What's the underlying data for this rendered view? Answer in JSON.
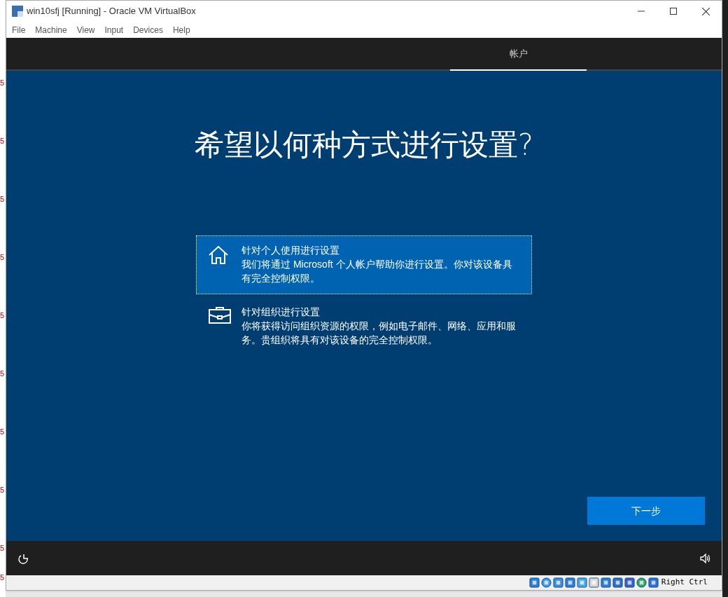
{
  "background": {
    "edge_marks": [
      "5",
      "5",
      "5",
      "5",
      "5",
      "5",
      "5",
      "5",
      "5",
      "5"
    ]
  },
  "window": {
    "title": "win10sfj [Running] - Oracle VM VirtualBox"
  },
  "menu": [
    "File",
    "Machine",
    "View",
    "Input",
    "Devices",
    "Help"
  ],
  "setup": {
    "tabs": [
      {
        "label": "帐户",
        "selected": true
      }
    ],
    "heading": "希望以何种方式进行设置?",
    "options": [
      {
        "kind": "personal",
        "title": "针对个人使用进行设置",
        "description": "我们将通过 Microsoft 个人帐户帮助你进行设置。你对该设备具有完全控制权限。",
        "selected": true
      },
      {
        "kind": "organization",
        "title": "针对组织进行设置",
        "description": "你将获得访问组织资源的权限，例如电子邮件、网络、应用和服务。贵组织将具有对该设备的完全控制权限。",
        "selected": false
      }
    ],
    "next_button": "下一步"
  },
  "status_bar": {
    "host_key": "Right Ctrl"
  }
}
